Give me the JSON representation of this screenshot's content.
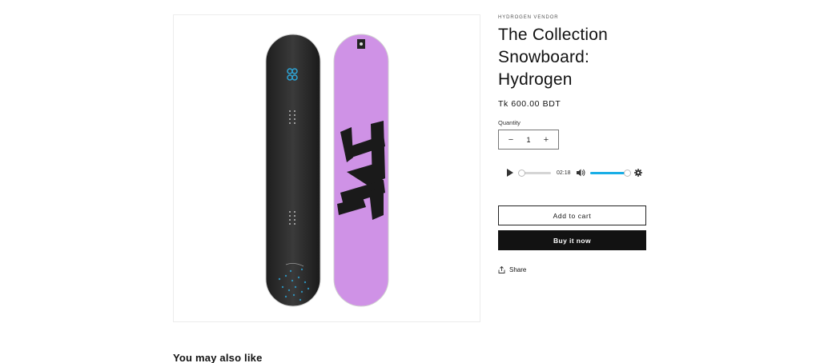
{
  "product": {
    "vendor": "HYDROGEN VENDOR",
    "title": "The Collection Snowboard: Hydrogen",
    "price": "Tk 600.00 BDT",
    "image_alt": "Hydrogen snowboards, black base and purple top"
  },
  "quantity": {
    "label": "Quantity",
    "value": "1",
    "decrease": "−",
    "increase": "+"
  },
  "audio": {
    "time": "02:18",
    "icons": {
      "play": "play-icon",
      "volume": "volume-icon",
      "settings": "gear-icon"
    },
    "accent": "#19aee6"
  },
  "actions": {
    "add_to_cart": "Add to cart",
    "buy_now": "Buy it now",
    "share": "Share"
  },
  "related": {
    "heading": "You may also like"
  },
  "colors": {
    "board_top": "#cf92e6",
    "board_base": "#2e2e2e",
    "button_dark": "#121212"
  }
}
